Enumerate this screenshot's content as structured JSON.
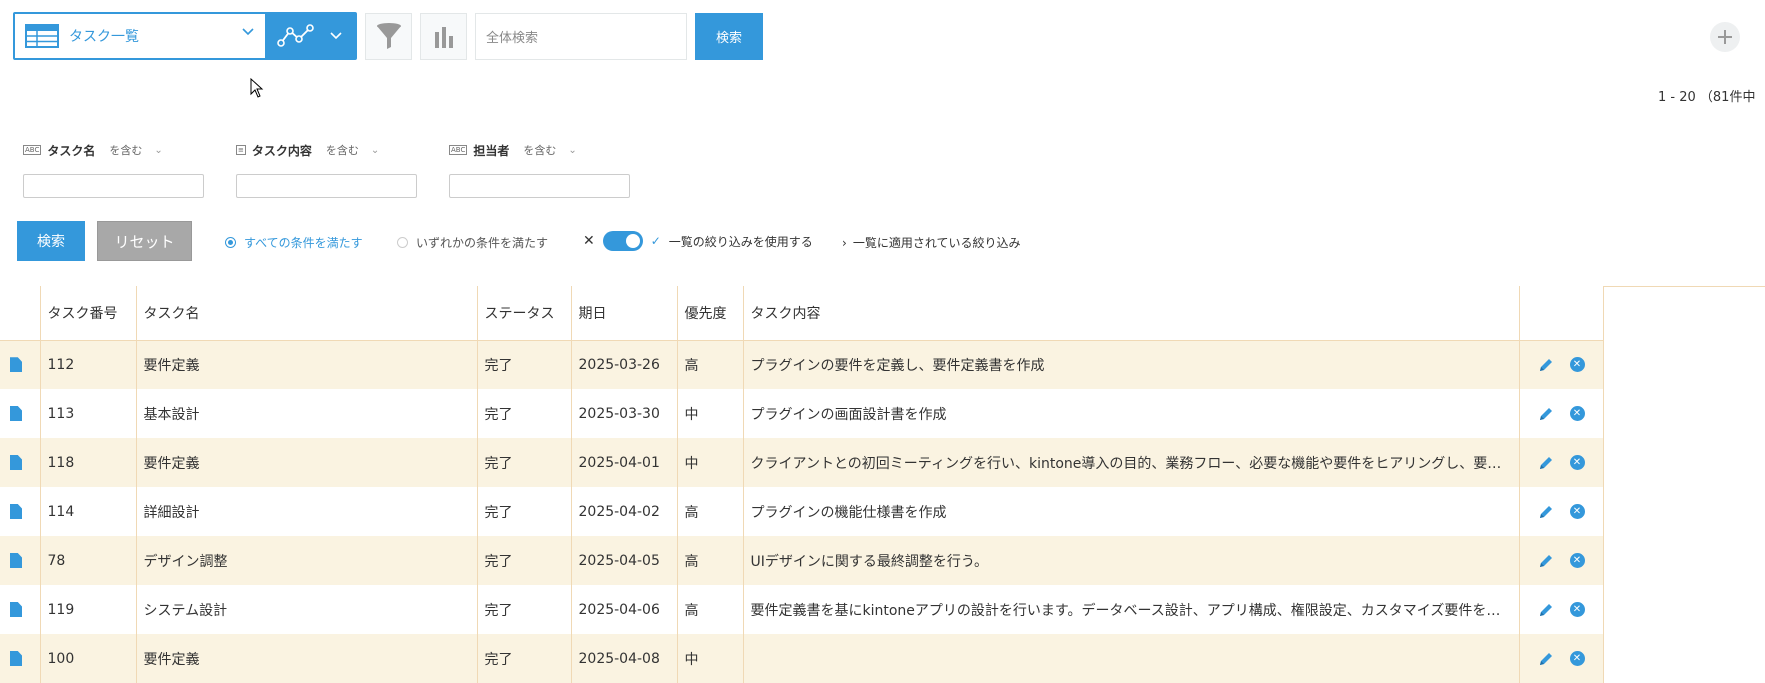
{
  "toolbar": {
    "view_label": "タスク一覧",
    "search_placeholder": "全体検索",
    "search_button": "検索"
  },
  "pager": {
    "text": "1 - 20 （81件中"
  },
  "filters": [
    {
      "type_badge": "ABC",
      "label": "タスク名",
      "operator": "を含む",
      "value": ""
    },
    {
      "type_badge": "≡",
      "label": "タスク内容",
      "operator": "を含む",
      "value": ""
    },
    {
      "type_badge": "ABC",
      "label": "担当者",
      "operator": "を含む",
      "value": ""
    }
  ],
  "actions": {
    "search": "検索",
    "reset": "リセット",
    "match_all": "すべての条件を満たす",
    "match_any": "いずれかの条件を満たす",
    "use_list_filter": "一覧の絞り込みを使用する",
    "applied_filter": "一覧に適用されている絞り込み"
  },
  "table": {
    "columns": [
      "タスク番号",
      "タスク名",
      "ステータス",
      "期日",
      "優先度",
      "タスク内容"
    ],
    "rows": [
      {
        "no": "112",
        "name": "要件定義",
        "status": "完了",
        "due": "2025-03-26",
        "priority": "高",
        "content": "プラグインの要件を定義し、要件定義書を作成"
      },
      {
        "no": "113",
        "name": "基本設計",
        "status": "完了",
        "due": "2025-03-30",
        "priority": "中",
        "content": "プラグインの画面設計書を作成"
      },
      {
        "no": "118",
        "name": "要件定義",
        "status": "完了",
        "due": "2025-04-01",
        "priority": "中",
        "content": "クライアントとの初回ミーティングを行い、kintone導入の目的、業務フロー、必要な機能や要件をヒアリングし、要…"
      },
      {
        "no": "114",
        "name": "詳細設計",
        "status": "完了",
        "due": "2025-04-02",
        "priority": "高",
        "content": "プラグインの機能仕様書を作成"
      },
      {
        "no": "78",
        "name": "デザイン調整",
        "status": "完了",
        "due": "2025-04-05",
        "priority": "高",
        "content": "UIデザインに関する最終調整を行う。"
      },
      {
        "no": "119",
        "name": "システム設計",
        "status": "完了",
        "due": "2025-04-06",
        "priority": "高",
        "content": "要件定義書を基にkintoneアプリの設計を行います。データベース設計、アプリ構成、権限設定、カスタマイズ要件を…"
      },
      {
        "no": "100",
        "name": "要件定義",
        "status": "完了",
        "due": "2025-04-08",
        "priority": "中",
        "content": ""
      }
    ]
  },
  "colors": {
    "accent": "#3498db",
    "row_odd": "#faf3e1",
    "border": "#f0d9b5"
  }
}
